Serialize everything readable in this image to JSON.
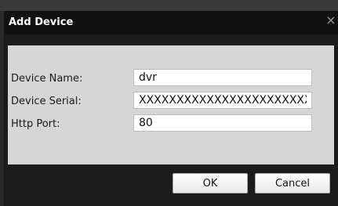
{
  "dialog": {
    "title": "Add Device",
    "close_icon": "close-icon",
    "fields": {
      "device_name": {
        "label": "Device Name:",
        "value": "dvr"
      },
      "device_serial": {
        "label": "Device Serial:",
        "value": "XXXXXXXXXXXXXXXXXXXXXXX"
      },
      "http_port": {
        "label": "Http Port:",
        "value": "80"
      }
    },
    "buttons": {
      "ok": "OK",
      "cancel": "Cancel"
    }
  }
}
